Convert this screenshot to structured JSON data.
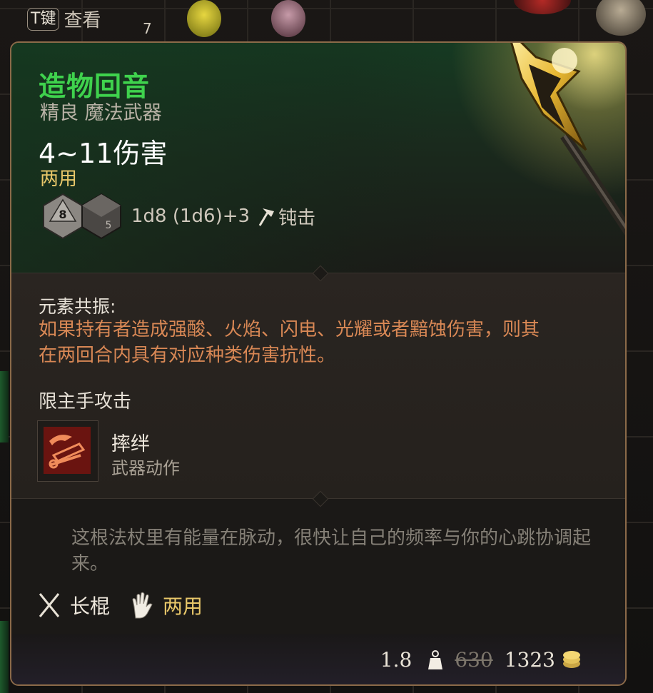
{
  "top_hint": {
    "key": "T键",
    "label": "查看",
    "stack_count": "7"
  },
  "item": {
    "name": "造物回音",
    "rarity_type": "精良 魔法武器",
    "damage": "4~11伤害",
    "handedness": "两用",
    "dice_formula": "1d8 (1d6)+3",
    "damage_type": "钝击",
    "die_faces": [
      "8",
      "5"
    ]
  },
  "resonance": {
    "title": "元素共振:",
    "description": "如果持有者造成强酸、火焰、闪电、光耀或者黯蚀伤害，则其在两回合内具有对应种类伤害抗性。"
  },
  "main_hand": "限主手攻击",
  "action": {
    "name": "摔绊",
    "type": "武器动作"
  },
  "flavor": "这根法杖里有能量在脉动，很快让自己的频率与你的心跳协调起来。",
  "tags": [
    {
      "icon": "crossed-staves-icon",
      "label": "长棍"
    },
    {
      "icon": "open-hand-icon",
      "label": "两用"
    }
  ],
  "footer": {
    "weight": "1.8",
    "old_price": "630",
    "price": "1323"
  },
  "colors": {
    "name": "#3fd24d",
    "accent_yellow": "#e9c86a",
    "desc_orange": "#d98855",
    "border": "#8b6a49"
  }
}
